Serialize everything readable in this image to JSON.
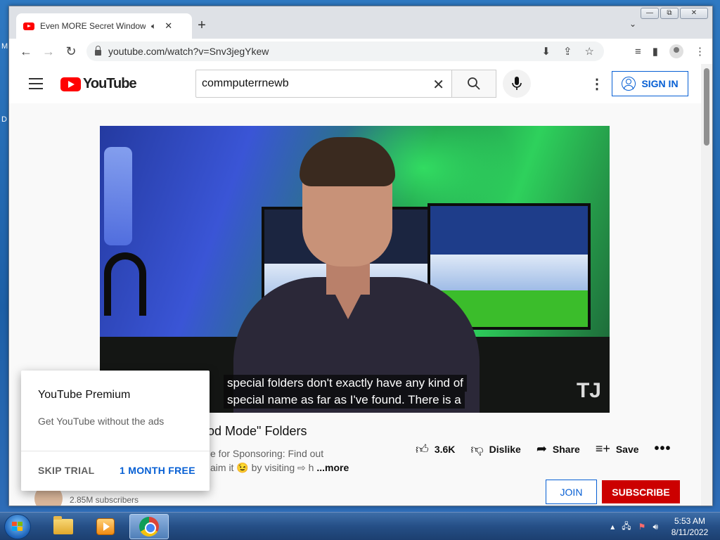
{
  "desktop": {
    "frag_top": "M",
    "frag_mid": "D"
  },
  "browser": {
    "tab_title": "Even MORE Secret Windows",
    "tab_audio_icon": "speaker-icon",
    "tab_close": "✕",
    "new_tab": "+",
    "tab_search": "⌄",
    "url": "youtube.com/watch?v=Snv3jegYkew",
    "window_controls": {
      "minimize": "▭",
      "restore": "⧉",
      "close": "✕"
    }
  },
  "youtube": {
    "logo_text": "YouTube",
    "search": {
      "value": "commputerrnewb",
      "placeholder": "Search"
    },
    "sign_in_label": "SIGN IN",
    "video": {
      "caption_line1": "special folders don't exactly have any kind of",
      "caption_line2": "special name as far as I've found. There is a",
      "watermark": "TJ"
    },
    "title_fragment": "iod Mode\" Folders",
    "description_line1": "e for Sponsoring: Find out",
    "description_line2": "aim it 😉 by visiting ⇨ h",
    "more_label": "...more",
    "actions": {
      "like_count": "3.6K",
      "dislike_label": "Dislike",
      "share_label": "Share",
      "save_label": "Save",
      "more": "..."
    },
    "channel": {
      "subscribers": "2.85M subscribers"
    },
    "join_label": "JOIN",
    "subscribe_label": "SUBSCRIBE"
  },
  "premium_popup": {
    "title": "YouTube Premium",
    "subtitle": "Get YouTube without the ads",
    "skip_label": "SKIP TRIAL",
    "free_label": "1 MONTH FREE"
  },
  "taskbar": {
    "apps": [
      "windows-explorer",
      "media-player",
      "chrome"
    ],
    "time": "5:53 AM",
    "date": "8/11/2022"
  },
  "colors": {
    "youtube_red": "#ff0000",
    "subscribe_red": "#cc0000",
    "link_blue": "#065fd4"
  }
}
